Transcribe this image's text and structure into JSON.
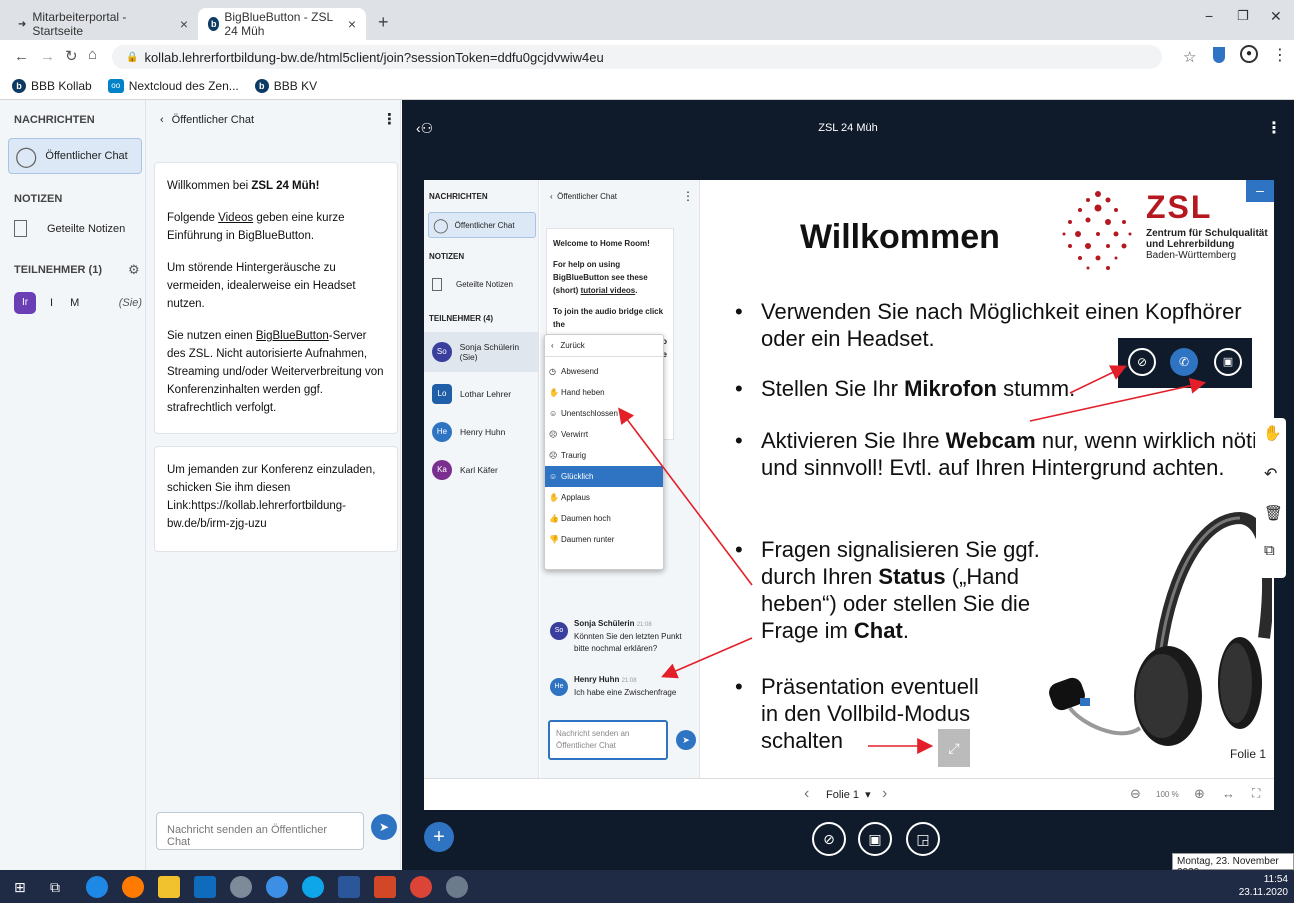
{
  "browser": {
    "tabs": [
      {
        "title": "Mitarbeiterportal - Startseite"
      },
      {
        "title": "BigBlueButton - ZSL 24 Müh"
      }
    ],
    "url": "kollab.lehrerfortbildung-bw.de/html5client/join?sessionToken=ddfu0gcjdvwiw4eu",
    "bookmarks": [
      "BBB Kollab",
      "Nextcloud des Zen...",
      "BBB KV"
    ]
  },
  "leftnav": {
    "messages_heading": "NACHRICHTEN",
    "public_chat": "Öffentlicher Chat",
    "notes_heading": "NOTIZEN",
    "shared_notes": "Geteilte Notizen",
    "participants_heading": "TEILNEHMER (1)",
    "user_avatar": "Ir",
    "user_name": "I M",
    "user_self": "(Sie)"
  },
  "chat": {
    "header": "Öffentlicher Chat",
    "welcome_prefix": "Willkommen bei ",
    "welcome_room": "ZSL 24 Müh!",
    "p1_a": "Folgende ",
    "p1_link": "Videos",
    "p1_b": " geben eine kurze Einführung in BigBlueButton.",
    "p2": "Um störende Hintergeräusche zu vermeiden, idealerweise ein Headset nutzen.",
    "p3_a": "Sie nutzen einen ",
    "p3_link": "BigBlueButton",
    "p3_b": "-Server des ZSL. Nicht autorisierte Aufnahmen, Streaming und/oder Weiterverbreitung von Konferenzinhalten werden ggf. strafrechtlich verfolgt.",
    "invite": "Um jemanden zur Konferenz einzuladen, schicken Sie ihm diesen Link:https://kollab.lehrerfortbildung-bw.de/b/irm-zjg-uzu",
    "input_placeholder": "Nachricht senden an Öffentlicher Chat"
  },
  "meeting": {
    "title": "ZSL 24 Müh"
  },
  "slide": {
    "heading": "Willkommen",
    "zsl_logo": "ZSL",
    "zsl_line1": "Zentrum für Schulqualität",
    "zsl_line2": "und Lehrerbildung",
    "zsl_line3": "Baden-Württemberg",
    "b1_l1": "Verwenden Sie nach Möglichkeit einen Kopfhörer",
    "b1_l2": "oder ein Headset.",
    "b2_a": "Stellen Sie Ihr ",
    "b2_bold": "Mikrofon",
    "b2_b": " stumm.",
    "b3_a": "Aktivieren Sie Ihre ",
    "b3_bold": "Webcam",
    "b3_b": " nur, wenn wirklich nötig",
    "b3_l2": "und sinnvoll! Evtl. auf Ihren Hintergrund achten.",
    "b4_l1": "Fragen signalisieren Sie ggf.",
    "b4_l2a": "durch Ihren ",
    "b4_l2bold": "Status",
    "b4_l2b": " („Hand",
    "b4_l3": "heben“) oder stellen Sie die",
    "b4_l4a": "Frage im ",
    "b4_l4bold": "Chat",
    "b4_l4b": ".",
    "b5_l1": "Präsentation eventuell",
    "b5_l2": "in den Vollbild-Modus",
    "b5_l3": "schalten",
    "folie_label": "Folie 1"
  },
  "inner": {
    "messages_heading": "NACHRICHTEN",
    "public_chat": "Öffentlicher Chat",
    "notes_heading": "NOTIZEN",
    "shared_notes": "Geteilte Notizen",
    "participants_heading": "TEILNEHMER (4)",
    "participants": [
      {
        "avatar": "So",
        "name": "Sonja Schülerin (Sie)"
      },
      {
        "avatar": "Lo",
        "name": "Lothar Lehrer"
      },
      {
        "avatar": "He",
        "name": "Henry Huhn"
      },
      {
        "avatar": "Ka",
        "name": "Karl Käfer"
      }
    ],
    "chat_header": "Öffentlicher Chat",
    "welcome_a": "Welcome to ",
    "welcome_b": "Home Room!",
    "help_a": "For help on using BigBlueButton see these (short) ",
    "help_link": "tutorial videos",
    "help_b": ".",
    "audio_a": "To join the audio bridge click the",
    "audio_frag1": "to",
    "audio_frag2": "oise",
    "menu_back": "Zurück",
    "menu_items": [
      "Abwesend",
      "Hand heben",
      "Unentschlossen",
      "Verwirrt",
      "Traurig",
      "Glücklich",
      "Applaus",
      "Daumen hoch",
      "Daumen runter"
    ],
    "msg1_name": "Sonja Schülerin",
    "msg1_time": "21:08",
    "msg1_text": "Könnten Sie den letzten Punkt bitte nochmal erklären?",
    "msg2_name": "Henry Huhn",
    "msg2_time": "21:08",
    "msg2_text": "Ich habe eine Zwischenfrage",
    "input_placeholder": "Nachricht senden an Öffentlicher Chat"
  },
  "presentation_bar": {
    "slide_label": "Folie 1",
    "zoom": "100 %"
  },
  "taskbar": {
    "date_tooltip": "Montag, 23. November 2020",
    "time": "11:54",
    "date": "23.11.2020"
  },
  "colors": {
    "bbb_blue": "#2f74c2",
    "dark_bg": "#0f1b2a",
    "zsl_red": "#b5181f",
    "arrow_red": "#e3202a"
  }
}
